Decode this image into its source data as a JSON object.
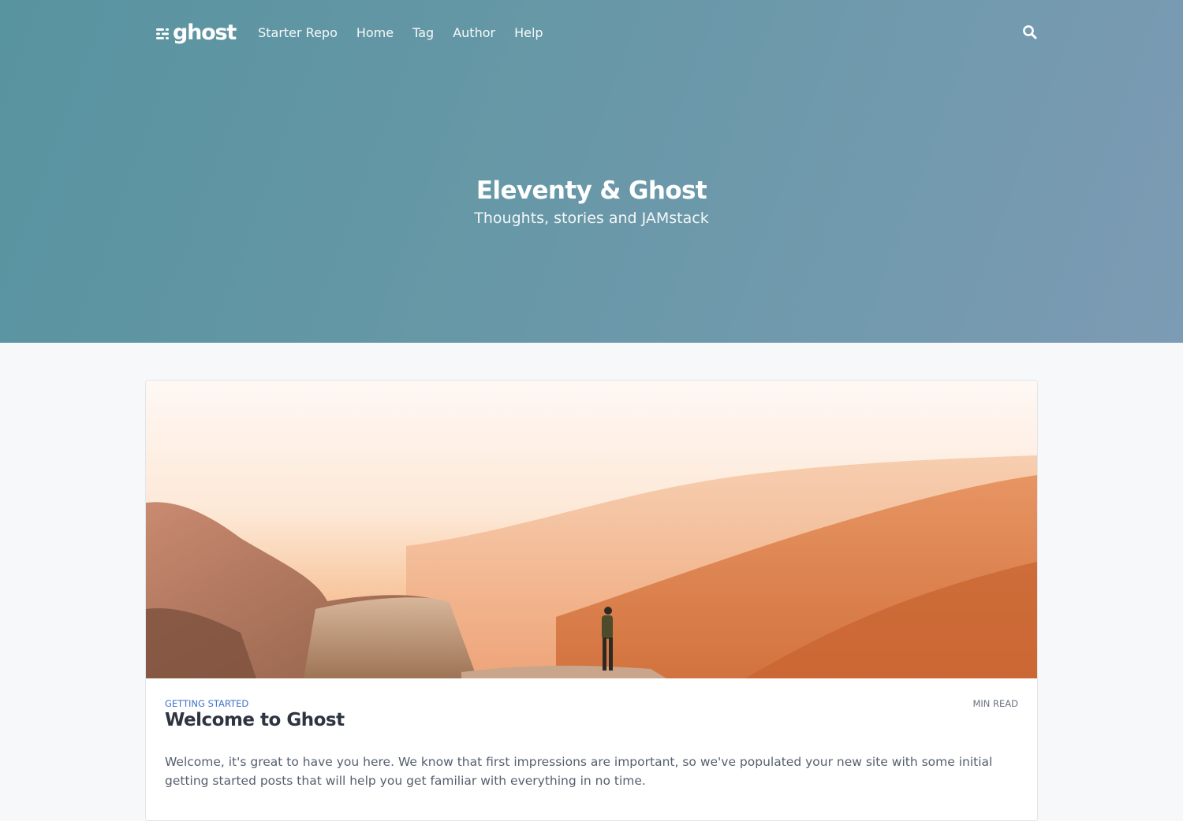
{
  "site": {
    "logo_text": "ghost",
    "logo_icon": "ghost-logo-icon",
    "title": "Eleventy & Ghost",
    "description": "Thoughts, stories and JAMstack"
  },
  "nav": {
    "items": [
      {
        "label": "Starter Repo"
      },
      {
        "label": "Home"
      },
      {
        "label": "Tag"
      },
      {
        "label": "Author"
      },
      {
        "label": "Help"
      }
    ],
    "search_icon": "search-icon"
  },
  "colors": {
    "hero_gradient_start": "#5893a0",
    "hero_gradient_end": "#7c9bb4",
    "tag": "#3d73c9",
    "page_background": "#f6f8fa"
  },
  "posts": [
    {
      "tag": "Getting Started",
      "reading_time": "MIN READ",
      "title": "Welcome to Ghost",
      "excerpt": "Welcome, it's great to have you here. We know that first impressions are important, so we've populated your new site with some initial getting started posts that will help you get familiar with everything in no time.",
      "image": "mountain-cliff-sunset-photo"
    }
  ]
}
